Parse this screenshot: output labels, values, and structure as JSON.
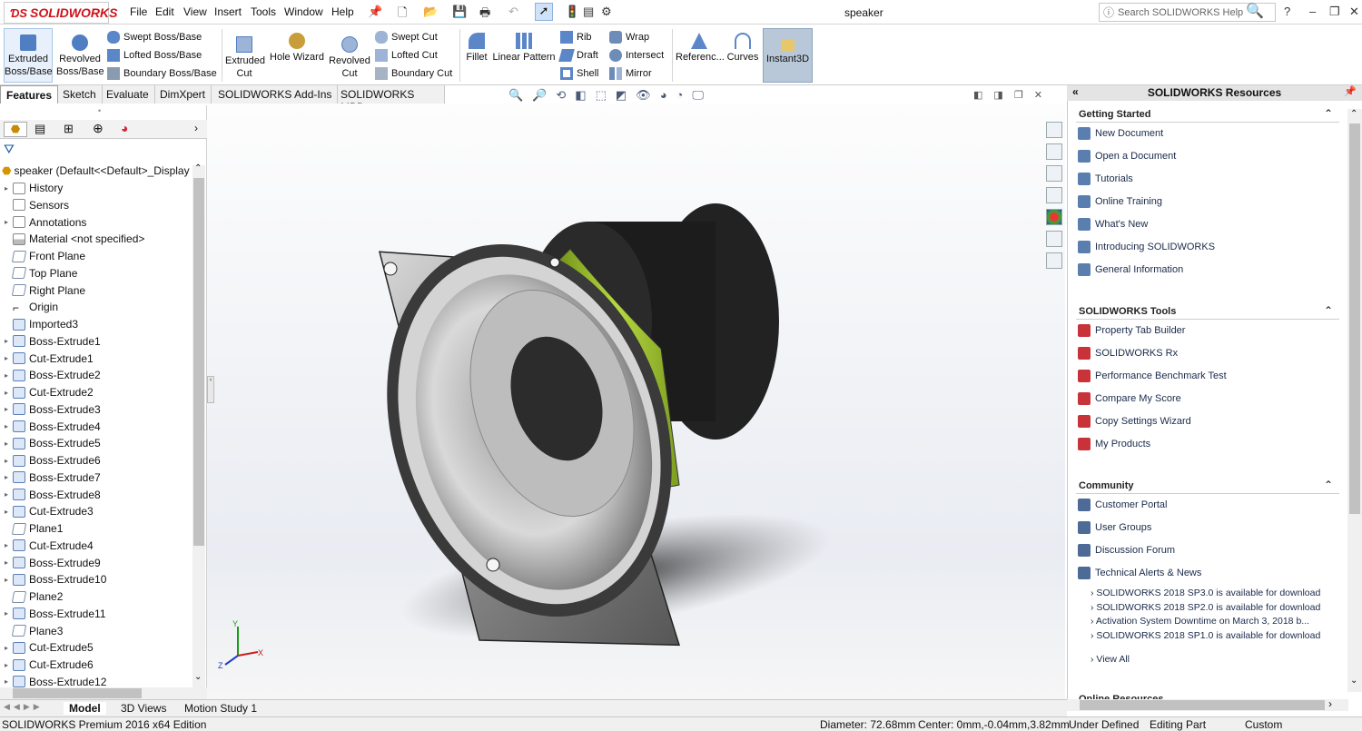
{
  "app": {
    "brand": "SOLIDWORKS",
    "document_title": "speaker"
  },
  "menu": [
    "File",
    "Edit",
    "View",
    "Insert",
    "Tools",
    "Window",
    "Help"
  ],
  "search": {
    "placeholder": "Search SOLIDWORKS Help"
  },
  "ribbon": {
    "extruded_boss": "Extruded Boss/Base",
    "revolved_boss": "Revolved Boss/Base",
    "swept_boss": "Swept Boss/Base",
    "lofted_boss": "Lofted Boss/Base",
    "boundary_boss": "Boundary Boss/Base",
    "extruded_cut": "Extruded Cut",
    "hole_wizard": "Hole Wizard",
    "revolved_cut": "Revolved Cut",
    "swept_cut": "Swept Cut",
    "lofted_cut": "Lofted Cut",
    "boundary_cut": "Boundary Cut",
    "fillet": "Fillet",
    "linear_pattern": "Linear Pattern",
    "rib": "Rib",
    "draft": "Draft",
    "shell": "Shell",
    "wrap": "Wrap",
    "intersect": "Intersect",
    "mirror": "Mirror",
    "reference": "Referenc...",
    "curves": "Curves",
    "instant3d": "Instant3D"
  },
  "tabs": [
    "Features",
    "Sketch",
    "Evaluate",
    "DimXpert",
    "SOLIDWORKS Add-Ins",
    "SOLIDWORKS MBD"
  ],
  "tree": {
    "root": "speaker  (Default<<Default>_Display",
    "items": [
      {
        "label": "History",
        "expand": true,
        "kind": "folder"
      },
      {
        "label": "Sensors",
        "expand": false,
        "kind": "folder"
      },
      {
        "label": "Annotations",
        "expand": true,
        "kind": "folder"
      },
      {
        "label": "Material <not specified>",
        "expand": false,
        "kind": "material"
      },
      {
        "label": "Front Plane",
        "expand": false,
        "kind": "plane"
      },
      {
        "label": "Top Plane",
        "expand": false,
        "kind": "plane"
      },
      {
        "label": "Right Plane",
        "expand": false,
        "kind": "plane"
      },
      {
        "label": "Origin",
        "expand": false,
        "kind": "origin"
      },
      {
        "label": "Imported3",
        "expand": false,
        "kind": "feature"
      },
      {
        "label": "Boss-Extrude1",
        "expand": true,
        "kind": "feature"
      },
      {
        "label": "Cut-Extrude1",
        "expand": true,
        "kind": "feature"
      },
      {
        "label": "Boss-Extrude2",
        "expand": true,
        "kind": "feature"
      },
      {
        "label": "Cut-Extrude2",
        "expand": true,
        "kind": "feature"
      },
      {
        "label": "Boss-Extrude3",
        "expand": true,
        "kind": "feature"
      },
      {
        "label": "Boss-Extrude4",
        "expand": true,
        "kind": "feature"
      },
      {
        "label": "Boss-Extrude5",
        "expand": true,
        "kind": "feature"
      },
      {
        "label": "Boss-Extrude6",
        "expand": true,
        "kind": "feature"
      },
      {
        "label": "Boss-Extrude7",
        "expand": true,
        "kind": "feature"
      },
      {
        "label": "Boss-Extrude8",
        "expand": true,
        "kind": "feature"
      },
      {
        "label": "Cut-Extrude3",
        "expand": true,
        "kind": "feature"
      },
      {
        "label": "Plane1",
        "expand": false,
        "kind": "plane"
      },
      {
        "label": "Cut-Extrude4",
        "expand": true,
        "kind": "feature"
      },
      {
        "label": "Boss-Extrude9",
        "expand": true,
        "kind": "feature"
      },
      {
        "label": "Boss-Extrude10",
        "expand": true,
        "kind": "feature"
      },
      {
        "label": "Plane2",
        "expand": false,
        "kind": "plane"
      },
      {
        "label": "Boss-Extrude11",
        "expand": true,
        "kind": "feature"
      },
      {
        "label": "Plane3",
        "expand": false,
        "kind": "plane"
      },
      {
        "label": "Cut-Extrude5",
        "expand": true,
        "kind": "feature"
      },
      {
        "label": "Cut-Extrude6",
        "expand": true,
        "kind": "feature"
      },
      {
        "label": "Boss-Extrude12",
        "expand": true,
        "kind": "feature"
      }
    ]
  },
  "taskpane": {
    "title": "SOLIDWORKS Resources",
    "getting_started": {
      "title": "Getting Started",
      "items": [
        "New Document",
        "Open a Document",
        "Tutorials",
        "Online Training",
        "What's New",
        "Introducing SOLIDWORKS",
        "General Information"
      ]
    },
    "tools": {
      "title": "SOLIDWORKS Tools",
      "items": [
        "Property Tab Builder",
        "SOLIDWORKS Rx",
        "Performance Benchmark Test",
        "Compare My Score",
        "Copy Settings Wizard",
        "My Products"
      ]
    },
    "community": {
      "title": "Community",
      "items": [
        "Customer Portal",
        "User Groups",
        "Discussion Forum",
        "Technical Alerts & News"
      ]
    },
    "news": [
      "SOLIDWORKS 2018 SP3.0 is available for download",
      "SOLIDWORKS 2018 SP2.0 is available for download",
      "Activation System Downtime on March 3, 2018 b...",
      "SOLIDWORKS 2018 SP1.0 is available for download"
    ],
    "view_all": "View All",
    "online_resources": "Online Resources"
  },
  "bottom_tabs": [
    "Model",
    "3D Views",
    "Motion Study 1"
  ],
  "triad": {
    "x": "X",
    "y": "Y",
    "z": "Z"
  },
  "status": {
    "edition": "SOLIDWORKS Premium 2016 x64 Edition",
    "diameter": "Diameter: 72.68mm",
    "center": "Center: 0mm,-0.04mm,3.82mm",
    "definition": "Under Defined",
    "mode": "Editing Part",
    "units": "Custom"
  },
  "colors": {
    "accent_green": "#a4c639",
    "brand_red": "#d0121b"
  }
}
